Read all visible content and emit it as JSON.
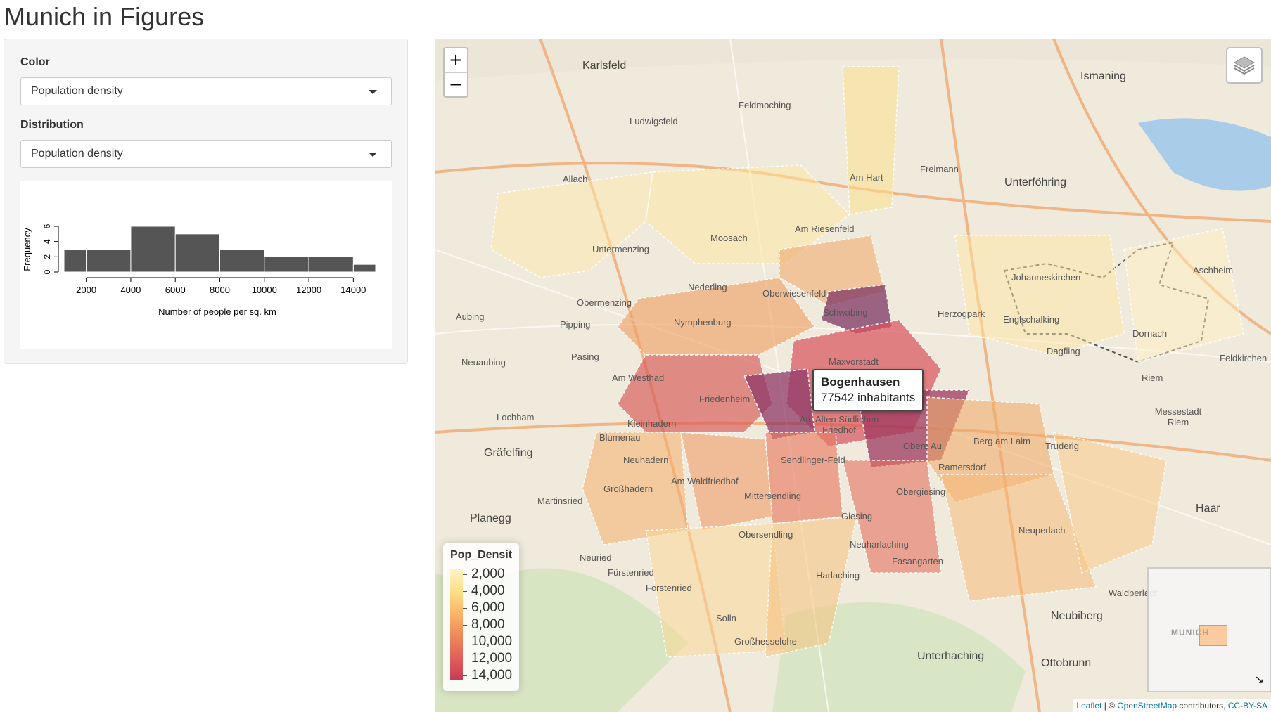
{
  "page": {
    "title": "Munich in Figures"
  },
  "controls": {
    "color": {
      "label": "Color",
      "value": "Population density"
    },
    "distribution": {
      "label": "Distribution",
      "value": "Population density"
    }
  },
  "chart_data": {
    "type": "bar",
    "title": "",
    "xlabel": "Number of people per sq. km",
    "ylabel": "Frequency",
    "bins": [
      {
        "from": 1000,
        "to": 2000,
        "count": 3
      },
      {
        "from": 2000,
        "to": 4000,
        "count": 3
      },
      {
        "from": 4000,
        "to": 6000,
        "count": 6
      },
      {
        "from": 6000,
        "to": 8000,
        "count": 5
      },
      {
        "from": 8000,
        "to": 10000,
        "count": 3
      },
      {
        "from": 10000,
        "to": 12000,
        "count": 2
      },
      {
        "from": 12000,
        "to": 14000,
        "count": 2
      },
      {
        "from": 14000,
        "to": 15000,
        "count": 1
      }
    ],
    "xticks": [
      "2000",
      "4000",
      "6000",
      "8000",
      "10000",
      "12000",
      "14000"
    ],
    "yticks": [
      "0",
      "2",
      "4",
      "6"
    ],
    "xlim": [
      1000,
      15000
    ],
    "ylim": [
      0,
      6
    ],
    "bar_color": "#555555"
  },
  "map": {
    "zoom_in": "+",
    "zoom_out": "−",
    "layers_icon": "layers-icon",
    "legend": {
      "title": "Pop_Densit",
      "labels": [
        "2,000",
        "4,000",
        "6,000",
        "8,000",
        "10,000",
        "12,000",
        "14,000"
      ]
    },
    "tooltip": {
      "name": "Bogenhausen",
      "detail": "77542 inhabitants"
    },
    "minimap": {
      "label": "MUNICH",
      "toggle": "↘"
    },
    "attribution": {
      "leaflet": "Leaflet",
      "sep": " | © ",
      "osm": "OpenStreetMap",
      "contributors": " contributors, ",
      "license": "CC-BY-SA"
    },
    "labels": [
      {
        "id": "karlsfeld",
        "text": "Karlsfeld"
      },
      {
        "id": "ismaning",
        "text": "Ismaning"
      },
      {
        "id": "feldmoching",
        "text": "Feldmoching"
      },
      {
        "id": "ludwigsfeld",
        "text": "Ludwigsfeld"
      },
      {
        "id": "freimann",
        "text": "Freimann"
      },
      {
        "id": "unterfoehring",
        "text": "Unterföhring"
      },
      {
        "id": "allach",
        "text": "Allach"
      },
      {
        "id": "amhart",
        "text": "Am Hart"
      },
      {
        "id": "moosach",
        "text": "Moosach"
      },
      {
        "id": "amriesenfeld",
        "text": "Am Riesenfeld"
      },
      {
        "id": "untermenzing",
        "text": "Untermenzing"
      },
      {
        "id": "nederling",
        "text": "Nederling"
      },
      {
        "id": "obermenzing",
        "text": "Obermenzing"
      },
      {
        "id": "oberwiesenfeld",
        "text": "Oberwiesenfeld"
      },
      {
        "id": "schwabing",
        "text": "Schwabing"
      },
      {
        "id": "nymphenburg",
        "text": "Nymphenburg"
      },
      {
        "id": "pipping",
        "text": "Pipping"
      },
      {
        "id": "aubing",
        "text": "Aubing"
      },
      {
        "id": "johanneskirchen",
        "text": "Johanneskirchen"
      },
      {
        "id": "englschalking",
        "text": "Englschalking"
      },
      {
        "id": "herzogpark",
        "text": "Herzogpark"
      },
      {
        "id": "maxvorstadt",
        "text": "Maxvorstadt"
      },
      {
        "id": "pasing",
        "text": "Pasing"
      },
      {
        "id": "amwesthad",
        "text": "Am Westhad"
      },
      {
        "id": "friedenheim",
        "text": "Friedenheim"
      },
      {
        "id": "dagfling",
        "text": "Dagfling"
      },
      {
        "id": "riem",
        "text": "Riem"
      },
      {
        "id": "grafelfing",
        "text": "Gräfelfing"
      },
      {
        "id": "lochham",
        "text": "Lochham"
      },
      {
        "id": "blumenau",
        "text": "Blumenau"
      },
      {
        "id": "neuhadern",
        "text": "Neuhadern"
      },
      {
        "id": "bergamlaim",
        "text": "Berg am Laim"
      },
      {
        "id": "truderig",
        "text": "Truderig"
      },
      {
        "id": "ramersdorf",
        "text": "Ramersdorf"
      },
      {
        "id": "sendling",
        "text": "Sendlinger-Feld"
      },
      {
        "id": "amwaldfriedhof",
        "text": "Am Waldfriedhof"
      },
      {
        "id": "grosshadern",
        "text": "Großhadern"
      },
      {
        "id": "mittersendling",
        "text": "Mittersendling"
      },
      {
        "id": "obergiesing",
        "text": "Obergiesing"
      },
      {
        "id": "planegg",
        "text": "Planegg"
      },
      {
        "id": "martinsried",
        "text": "Martinsried"
      },
      {
        "id": "giesing",
        "text": "Giesing"
      },
      {
        "id": "neuperlach",
        "text": "Neuperlach"
      },
      {
        "id": "haar",
        "text": "Haar"
      },
      {
        "id": "obersendling",
        "text": "Obersendling"
      },
      {
        "id": "neuharlaching",
        "text": "Neuharlaching"
      },
      {
        "id": "fasangarten",
        "text": "Fasangarten"
      },
      {
        "id": "fuerstenried",
        "text": "Fürstenried"
      },
      {
        "id": "forstenried",
        "text": "Forstenried"
      },
      {
        "id": "harlaching",
        "text": "Harlaching"
      },
      {
        "id": "waldperlach",
        "text": "Waldperlach"
      },
      {
        "id": "neubiberg",
        "text": "Neubiberg"
      },
      {
        "id": "solln",
        "text": "Solln"
      },
      {
        "id": "grosshesselohe",
        "text": "Großhesselohe"
      },
      {
        "id": "unterhaching",
        "text": "Unterhaching"
      },
      {
        "id": "ottobrunn",
        "text": "Ottobrunn"
      },
      {
        "id": "neuried",
        "text": "Neuried"
      },
      {
        "id": "amaltensuedlichen",
        "text": "Am Alten Südlichen Friedhof"
      },
      {
        "id": "obereau",
        "text": "Obere Au"
      },
      {
        "id": "dornach",
        "text": "Dornach"
      },
      {
        "id": "feldkirchen",
        "text": "Feldkirchen"
      },
      {
        "id": "messestadt",
        "text": "Messestadt Riem"
      },
      {
        "id": "aschheim",
        "text": "Aschheim"
      },
      {
        "id": "neuaubing",
        "text": "Neuaubing"
      },
      {
        "id": "kleinhadern",
        "text": "Kleinhadern"
      }
    ]
  }
}
